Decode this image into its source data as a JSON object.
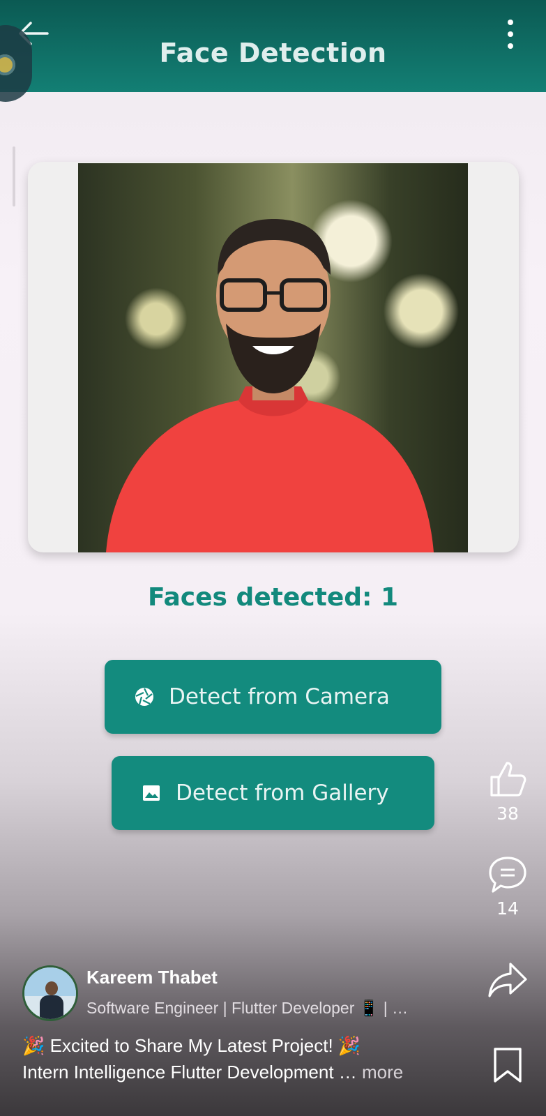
{
  "app_bar": {
    "title": "Face Detection",
    "back_icon": "arrow-left-icon",
    "menu_icon": "more-vertical-icon",
    "background": "#117a70"
  },
  "image_card": {
    "photo_alt": "portrait-photo"
  },
  "result": {
    "caption": "Faces detected: 1"
  },
  "buttons": {
    "camera": {
      "label": "Detect from Camera",
      "icon": "camera-shutter-icon"
    },
    "gallery": {
      "label": "Detect from Gallery",
      "icon": "image-icon"
    },
    "accent": "#138b7e"
  },
  "post_actions": {
    "like_count": "38",
    "comment_count": "14"
  },
  "author": {
    "name": "Kareem Thabet",
    "headline": "Software Engineer | Flutter Developer 📱 | …"
  },
  "post": {
    "line1": "🎉 Excited to Share My Latest Project! 🎉",
    "line2": "Intern Intelligence Flutter Development …",
    "more_label": " more"
  }
}
